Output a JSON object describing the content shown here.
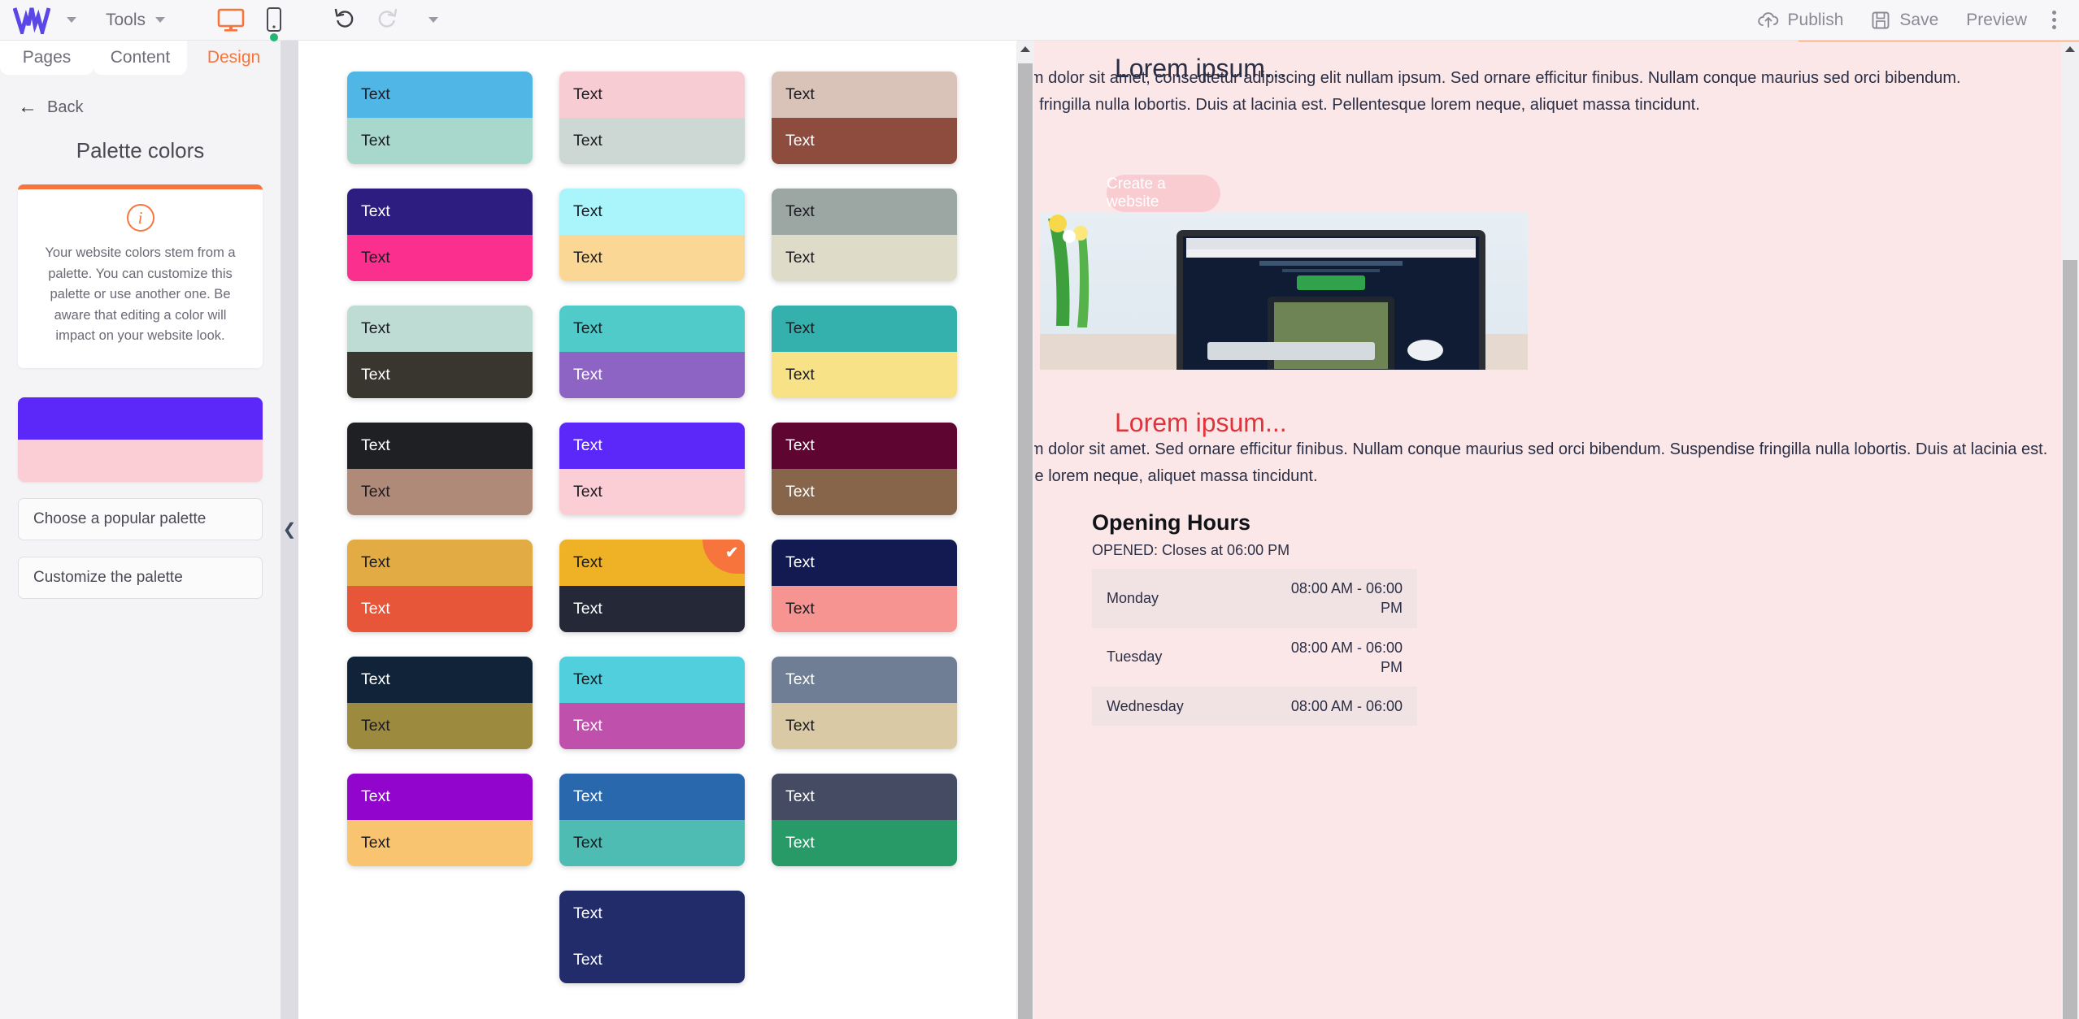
{
  "topbar": {
    "logo": "w-logo",
    "logo_caret_icon": "chevron-down-icon",
    "tools_label": "Tools",
    "tools_caret_icon": "chevron-down-icon",
    "desktop_icon": "desktop-monitor-icon",
    "mobile_icon": "mobile-phone-icon",
    "undo_icon": "undo-arrow-icon",
    "redo_icon": "redo-arrow-icon",
    "history_caret_icon": "chevron-down-icon",
    "publish_label": "Publish",
    "publish_icon": "cloud-upload-icon",
    "save_label": "Save",
    "save_icon": "floppy-disk-icon",
    "preview_label": "Preview",
    "more_icon": "kebab-menu-icon",
    "accent_color": "#f7753c"
  },
  "sidebar": {
    "tabs": [
      {
        "label": "Pages",
        "active": false
      },
      {
        "label": "Content",
        "active": false
      },
      {
        "label": "Design",
        "active": true
      }
    ],
    "back_label": "Back",
    "back_icon": "arrow-left-icon",
    "panel_title": "Palette colors",
    "info_icon": "info-circle-icon",
    "info_text": "Your website colors stem from a palette. You can customize this palette or use another one. Be aware that editing a color will impact on your website look.",
    "current_palette": {
      "primary": "#5c28fa",
      "secondary": "#fbcdd5"
    },
    "buttons": [
      {
        "label": "Choose a popular palette"
      },
      {
        "label": "Customize the palette"
      }
    ],
    "collapse_icon": "chevron-left-icon"
  },
  "palette_panel": {
    "swatch_text": "Text",
    "selected_index": 13,
    "check_icon": "check-mark-icon",
    "scrollbar_up_icon": "triangle-up-icon",
    "swatches": [
      {
        "top": "#4fb6e6",
        "bottom": "#a8d8cb",
        "top_text": "#1b1b22",
        "bottom_text": "#1b1b22"
      },
      {
        "top": "#f7ccd2",
        "bottom": "#cdd7d4",
        "top_text": "#1b1b22",
        "bottom_text": "#1b1b22"
      },
      {
        "top": "#d9c2b8",
        "bottom": "#8e4c3f",
        "top_text": "#1b1b22",
        "bottom_text": "#ffffff"
      },
      {
        "top": "#2e1d80",
        "bottom": "#fb2f8d",
        "top_text": "#ffffff",
        "bottom_text": "#1b1b22"
      },
      {
        "top": "#aaf4fb",
        "bottom": "#fbd795",
        "top_text": "#1b1b22",
        "bottom_text": "#1b1b22"
      },
      {
        "top": "#9ca6a3",
        "bottom": "#dedcc9",
        "top_text": "#1b1b22",
        "bottom_text": "#1b1b22"
      },
      {
        "top": "#bedcd4",
        "bottom": "#38362f",
        "top_text": "#1b1b22",
        "bottom_text": "#ffffff"
      },
      {
        "top": "#50cbc9",
        "bottom": "#8d63c4",
        "top_text": "#1b1b22",
        "bottom_text": "#ffffff"
      },
      {
        "top": "#35b1ad",
        "bottom": "#f8e287",
        "top_text": "#1b1b22",
        "bottom_text": "#1b1b22"
      },
      {
        "top": "#1e2024",
        "bottom": "#b08a78",
        "top_text": "#ffffff",
        "bottom_text": "#1b1b22"
      },
      {
        "top": "#5c28fa",
        "bottom": "#fbcdd5",
        "top_text": "#ffffff",
        "bottom_text": "#1b1b22"
      },
      {
        "top": "#5e0631",
        "bottom": "#87654a",
        "top_text": "#ffffff",
        "bottom_text": "#ffffff"
      },
      {
        "top": "#e3ab43",
        "bottom": "#e75638",
        "top_text": "#1b1b22",
        "bottom_text": "#ffffff"
      },
      {
        "top": "#efb226",
        "bottom": "#252837",
        "top_text": "#1b1b22",
        "bottom_text": "#ffffff"
      },
      {
        "top": "#131a52",
        "bottom": "#f69491",
        "top_text": "#ffffff",
        "bottom_text": "#1b1b22"
      },
      {
        "top": "#112339",
        "bottom": "#9c8a3f",
        "top_text": "#ffffff",
        "bottom_text": "#1b1b22"
      },
      {
        "top": "#51cfdc",
        "bottom": "#bf50ab",
        "top_text": "#1b1b22",
        "bottom_text": "#ffffff"
      },
      {
        "top": "#6f7e94",
        "bottom": "#d9c9a5",
        "top_text": "#ffffff",
        "bottom_text": "#1b1b22"
      },
      {
        "top": "#9205cc",
        "bottom": "#f9c470",
        "top_text": "#ffffff",
        "bottom_text": "#1b1b22"
      },
      {
        "top": "#2a68ae",
        "bottom": "#4fbcb3",
        "top_text": "#ffffff",
        "bottom_text": "#1b1b22"
      },
      {
        "top": "#454b63",
        "bottom": "#279a68",
        "top_text": "#ffffff",
        "bottom_text": "#ffffff"
      },
      {
        "top": "#232c6b",
        "bottom": "#232c6b",
        "top_text": "#ffffff",
        "bottom_text": "#ffffff"
      }
    ]
  },
  "preview": {
    "heading_1": "Lorem ipsum...",
    "paragraph_1": "Lorem ipsum dolor sit amet, consectetur adipiscing elit nullam ipsum. Sed ornare efficitur finibus. Nullam conque maurius sed orci bibendum. Suspendise fringilla nulla lobortis. Duis at lacinia est. Pellentesque lorem neque, aliquet massa tincidunt.",
    "cta_label": "Create a website",
    "image": "imac-desktop-photo",
    "heading_2": "Lorem ipsum...",
    "paragraph_2": "Lorem ipsum dolor sit amet. Sed ornare efficitur finibus. Nullam conque maurius sed orci bibendum. Suspendise fringilla nulla lobortis. Duis at lacinia est. Pellentesque lorem neque, aliquet massa tincidunt.",
    "opening_hours": {
      "title": "Opening Hours",
      "status": "OPENED: Closes at 06:00 PM",
      "rows": [
        {
          "day": "Monday",
          "time": "08:00 AM - 06:00 PM"
        },
        {
          "day": "Tuesday",
          "time": "08:00 AM - 06:00 PM"
        },
        {
          "day": "Wednesday",
          "time": "08:00 AM - 06:00"
        }
      ]
    },
    "page_bg": "#fbe7e8",
    "side_bg": "#f3929d"
  }
}
